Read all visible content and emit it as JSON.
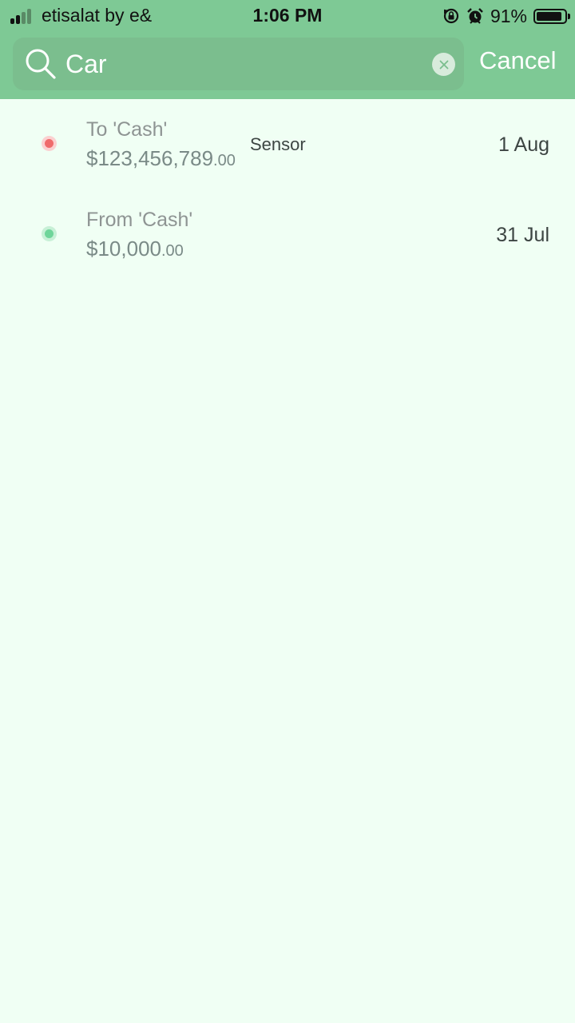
{
  "status_bar": {
    "carrier": "etisalat by e&",
    "time": "1:06 PM",
    "battery_percent": "91%",
    "battery_level": 0.91,
    "signal_bars": 2,
    "icons": [
      "orientation-lock-icon",
      "alarm-icon"
    ]
  },
  "search": {
    "query": "Car",
    "cancel_label": "Cancel"
  },
  "colors": {
    "header": "#7ec995",
    "background": "#f0fff4",
    "expense_dot": "#ef6b6b",
    "income_dot": "#6fd59a"
  },
  "results": [
    {
      "title": "To 'Cash'",
      "amount_main": "$123,456,789",
      "amount_cents": ".00",
      "note": "Sensor",
      "date": "1 Aug",
      "type": "expense"
    },
    {
      "title": "From 'Cash'",
      "amount_main": "$10,000",
      "amount_cents": ".00",
      "note": "",
      "date": "31 Jul",
      "type": "income"
    }
  ]
}
